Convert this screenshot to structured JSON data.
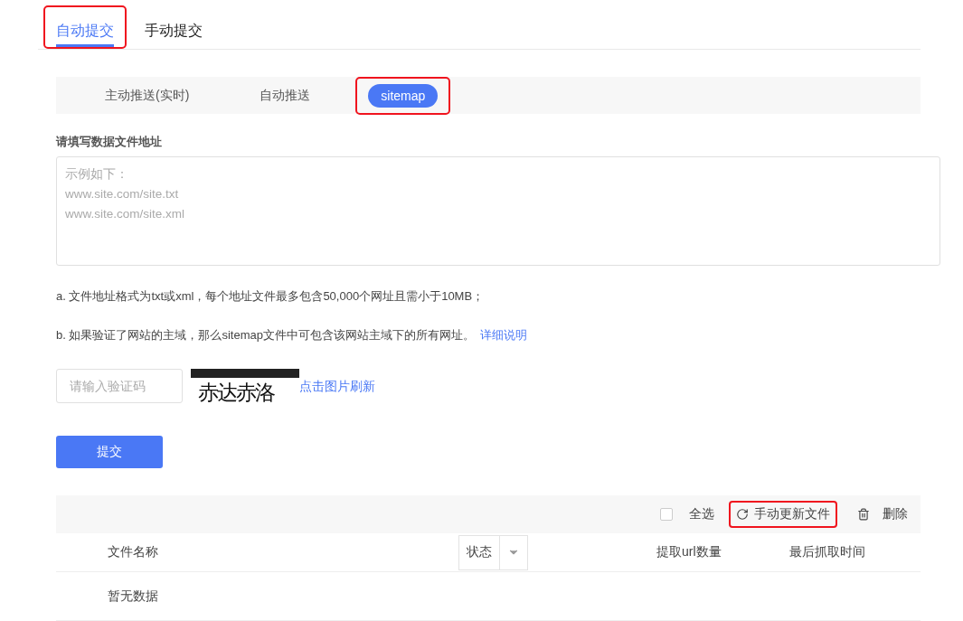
{
  "tabs": [
    {
      "label": "自动提交",
      "selected": true,
      "highlighted": true
    },
    {
      "label": "手动提交",
      "selected": false,
      "highlighted": false
    }
  ],
  "subtabs": [
    {
      "label": "主动推送(实时)",
      "selected": false,
      "highlighted": false
    },
    {
      "label": "自动推送",
      "selected": false,
      "highlighted": false
    },
    {
      "label": "sitemap",
      "selected": true,
      "highlighted": true
    }
  ],
  "form": {
    "label": "请填写数据文件地址",
    "placeholder": "示例如下：\nwww.site.com/site.txt\nwww.site.com/site.xml",
    "notes": [
      {
        "text": "a. 文件地址格式为txt或xml，每个地址文件最多包含50,000个网址且需小于10MB；"
      },
      {
        "text": "b. 如果验证了网站的主域，那么sitemap文件中可包含该网站主域下的所有网址。",
        "link": "详细说明"
      }
    ],
    "captcha": {
      "placeholder": "请输入验证码",
      "image_text": "赤达赤洛",
      "refresh": "点击图片刷新"
    },
    "submit": "提交"
  },
  "table": {
    "toolbar": {
      "select_all": {
        "label": "全选",
        "checked": false
      },
      "update": {
        "label": "手动更新文件",
        "highlighted": true
      },
      "delete": "删除"
    },
    "columns": [
      {
        "label": "文件名称",
        "kind": "text"
      },
      {
        "label": "状态",
        "kind": "filter"
      },
      {
        "label": "提取url数量",
        "kind": "text"
      },
      {
        "label": "最后抓取时间",
        "kind": "text"
      }
    ],
    "empty": "暂无数据"
  }
}
